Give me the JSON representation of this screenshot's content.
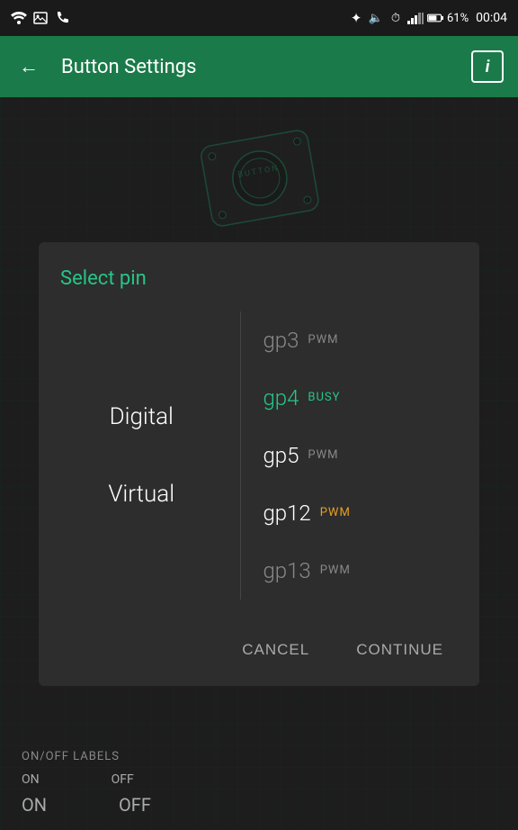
{
  "statusBar": {
    "time": "00:04",
    "battery": "61%",
    "icons": [
      "wifi",
      "signal",
      "alarm",
      "mute",
      "bluetooth"
    ]
  },
  "appBar": {
    "title": "Button Settings",
    "backLabel": "←",
    "infoLabel": "i"
  },
  "dialog": {
    "title": "Select pin",
    "categories": [
      {
        "id": "digital",
        "label": "Digital",
        "selected": true
      },
      {
        "id": "virtual",
        "label": "Virtual",
        "selected": false
      }
    ],
    "pins": [
      {
        "id": "gp3",
        "name": "gp3",
        "badge": "PWM",
        "nameColor": "grey",
        "badgeColor": "grey"
      },
      {
        "id": "gp4",
        "name": "gp4",
        "badge": "BUSY",
        "nameColor": "teal",
        "badgeColor": "teal"
      },
      {
        "id": "gp5",
        "name": "gp5",
        "badge": "PWM",
        "nameColor": "white",
        "badgeColor": "grey"
      },
      {
        "id": "gp12",
        "name": "gp12",
        "badge": "PWM",
        "nameColor": "white",
        "badgeColor": "yellow"
      },
      {
        "id": "gp13",
        "name": "gp13",
        "badge": "PWM",
        "nameColor": "grey",
        "badgeColor": "grey"
      }
    ],
    "cancelLabel": "CANCEL",
    "continueLabel": "CONTINUE"
  },
  "bottomSection": {
    "onOffLabels": "ON/OFF LABELS",
    "onLabel": "ON",
    "offLabel": "OFF",
    "onValue": "ON",
    "offValue": "OFF"
  }
}
